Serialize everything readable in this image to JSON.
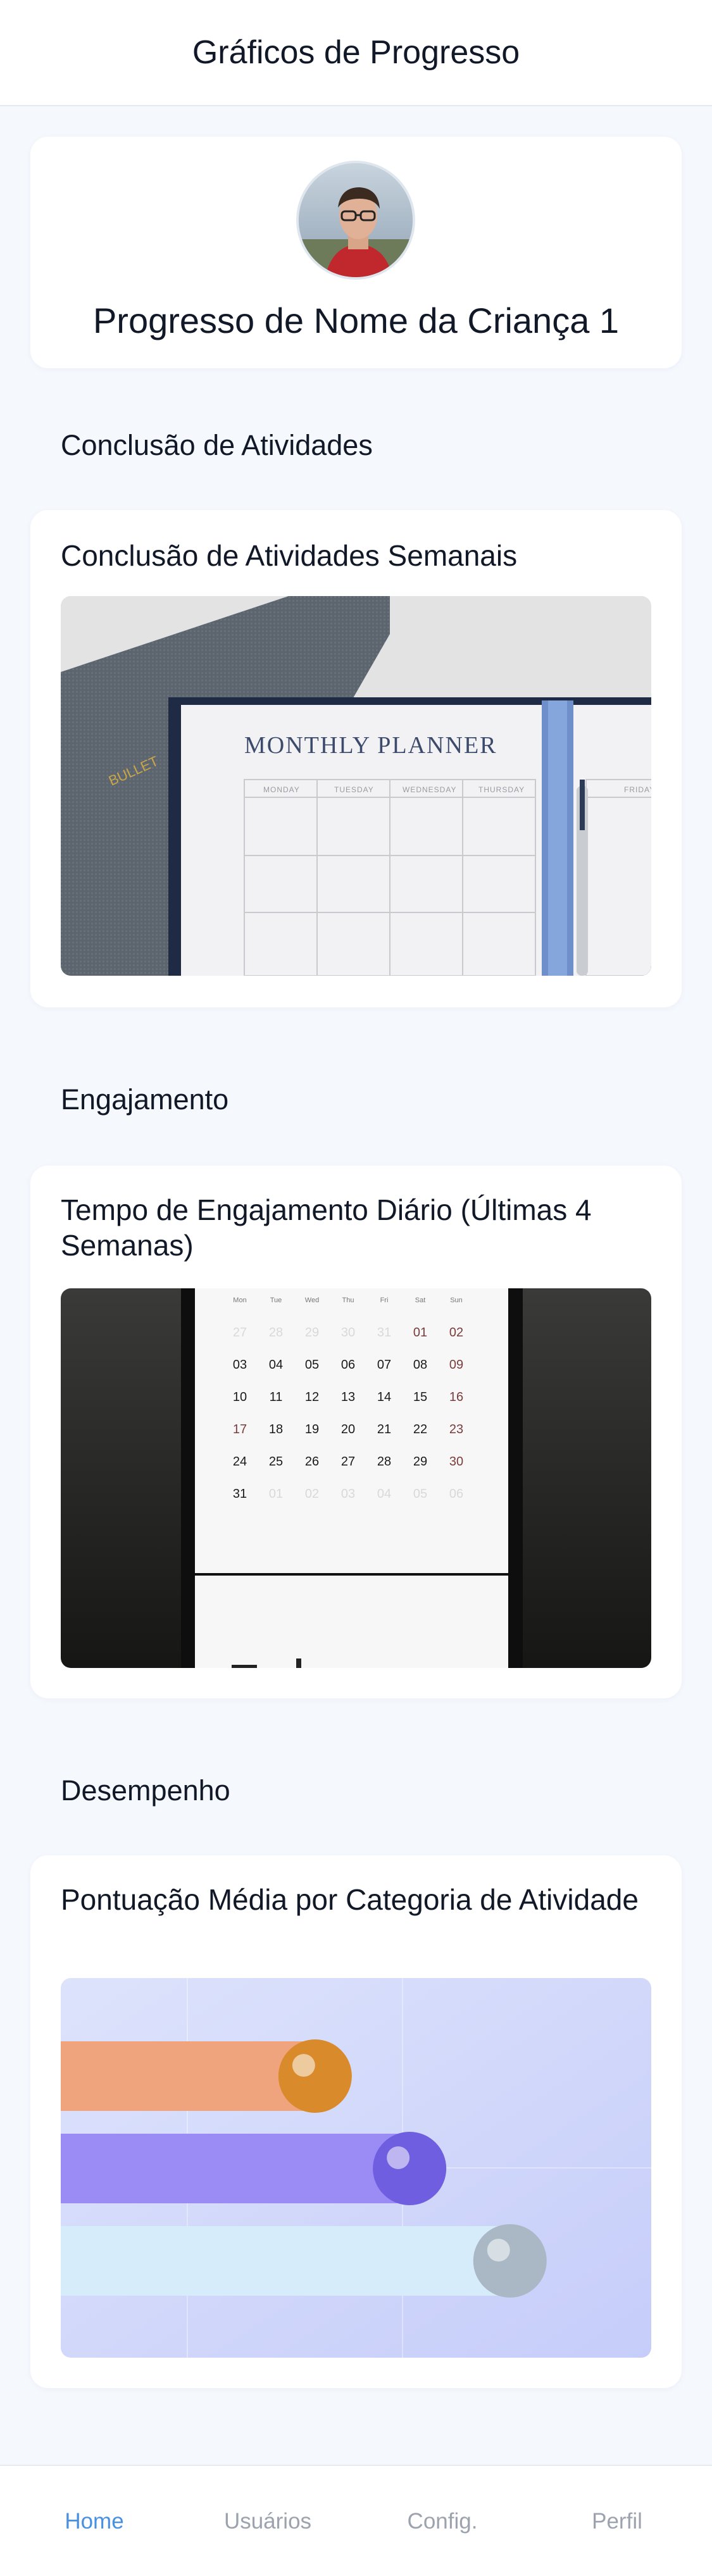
{
  "header": {
    "title": "Gráficos de Progresso"
  },
  "profile": {
    "name": "Progresso de Nome da Criança 1"
  },
  "sections": [
    {
      "title": "Conclusão de Atividades",
      "card_title": "Conclusão de Atividades Semanais"
    },
    {
      "title": "Engajamento",
      "card_title": "Tempo de Engajamento Diário (Últimas 4 Semanas)"
    },
    {
      "title": "Desempenho",
      "card_title": "Pontuação Média por Categoria de Atividade"
    }
  ],
  "planner": {
    "title": "MONTHLY PLANNER",
    "days": [
      "MONDAY",
      "TUESDAY",
      "WEDNESDAY",
      "THURSDAY",
      "FRIDAY"
    ],
    "book_label": "BULLET"
  },
  "calendar": {
    "weekdays": [
      "Mon",
      "Tue",
      "Wed",
      "Thu",
      "Fri",
      "Sat",
      "Sun"
    ],
    "rows": [
      [
        "27",
        "28",
        "29",
        "30",
        "31",
        "01",
        "02"
      ],
      [
        "03",
        "04",
        "05",
        "06",
        "07",
        "08",
        "09"
      ],
      [
        "10",
        "11",
        "12",
        "13",
        "14",
        "15",
        "16"
      ],
      [
        "17",
        "18",
        "19",
        "20",
        "21",
        "22",
        "23"
      ],
      [
        "24",
        "25",
        "26",
        "27",
        "28",
        "29",
        "30"
      ],
      [
        "31",
        "01",
        "02",
        "03",
        "04",
        "05",
        "06"
      ]
    ]
  },
  "bars": [
    {
      "color": "#f0a47e",
      "ball": "#d98a2b",
      "level": 0.42
    },
    {
      "color": "#9b8cf5",
      "ball": "#6f5ee0",
      "level": 0.58
    },
    {
      "color": "#d7ecfb",
      "ball": "#a9b8c4",
      "level": 0.75
    }
  ],
  "nav": [
    {
      "label": "Home",
      "active": true
    },
    {
      "label": "Usuários",
      "active": false
    },
    {
      "label": "Config.",
      "active": false
    },
    {
      "label": "Perfil",
      "active": false
    }
  ]
}
